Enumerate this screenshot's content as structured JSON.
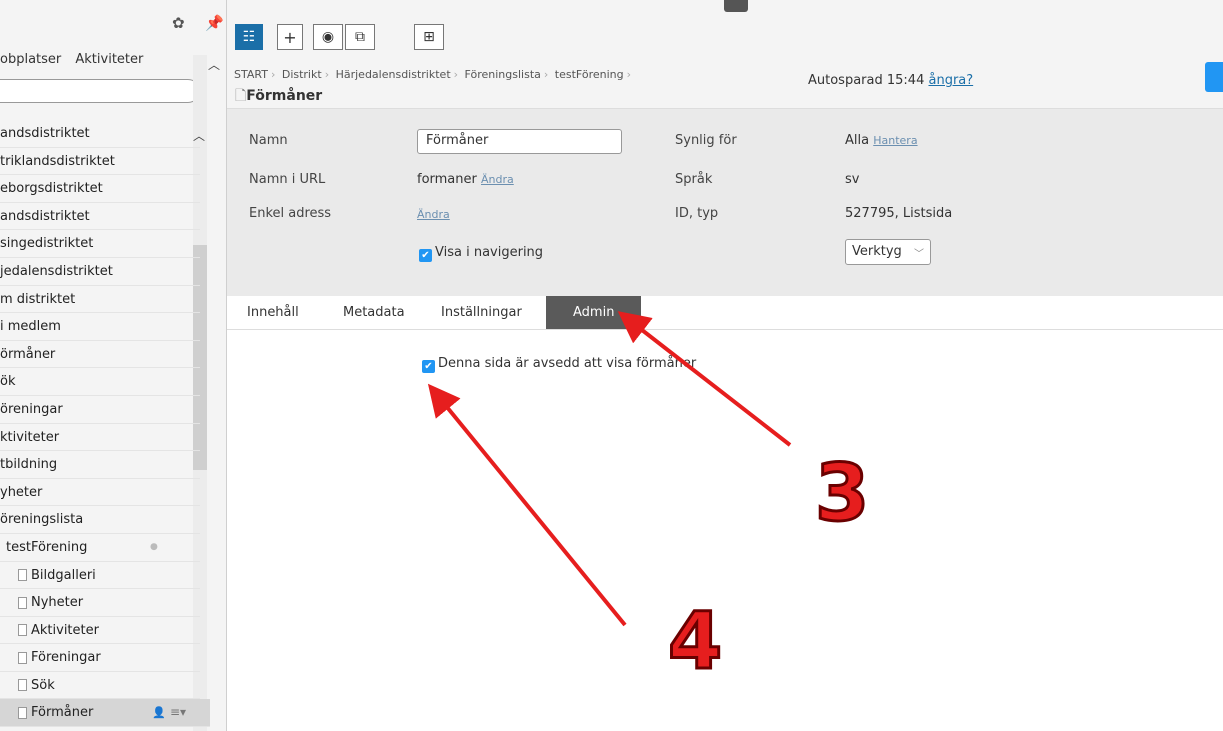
{
  "sidebar": {
    "tabs": [
      "obplatser",
      "Aktiviteter"
    ],
    "items": [
      {
        "label": "andsdistriktet"
      },
      {
        "label": "triklandsdistriktet"
      },
      {
        "label": "eborgsdistriktet"
      },
      {
        "label": "andsdistriktet"
      },
      {
        "label": "singedistriktet"
      },
      {
        "label": "jedalensdistriktet"
      },
      {
        "label": "m distriktet"
      },
      {
        "label": "i medlem"
      },
      {
        "label": "örmåner"
      },
      {
        "label": "ök"
      },
      {
        "label": "öreningar"
      },
      {
        "label": "ktiviteter"
      },
      {
        "label": "tbildning"
      },
      {
        "label": "yheter"
      },
      {
        "label": "öreningslista"
      },
      {
        "label": "testFörening"
      },
      {
        "label": "Bildgalleri"
      },
      {
        "label": "Nyheter"
      },
      {
        "label": "Aktiviteter"
      },
      {
        "label": "Föreningar"
      },
      {
        "label": "Sök"
      },
      {
        "label": "Förmåner"
      }
    ]
  },
  "breadcrumb": [
    "START",
    "Distrikt",
    "Härjedalensdistriktet",
    "Föreningslista",
    "testFörening"
  ],
  "page_title": "Förmåner",
  "autosave": {
    "text": "Autosparad 15:44",
    "undo": "ångra?"
  },
  "props": {
    "name_label": "Namn",
    "name_value": "Förmåner",
    "url_label": "Namn i URL",
    "url_value": "formaner",
    "url_change": "Ändra",
    "address_label": "Enkel adress",
    "address_change": "Ändra",
    "show_in_nav": "Visa i navigering",
    "visible_label": "Synlig för",
    "visible_value": "Alla",
    "visible_manage": "Hantera",
    "lang_label": "Språk",
    "lang_value": "sv",
    "id_label": "ID, typ",
    "id_value": "527795, Listsida",
    "tools": "Verktyg"
  },
  "tabs": [
    "Innehåll",
    "Metadata",
    "Inställningar",
    "Admin"
  ],
  "admin": {
    "checkbox_label": "Denna sida är avsedd att visa förmåner"
  },
  "annotations": {
    "three": "3",
    "four": "4"
  },
  "colors": {
    "accent": "#2196f3",
    "annotation": "#e61e1e",
    "active_tab": "#5a5a5a"
  }
}
